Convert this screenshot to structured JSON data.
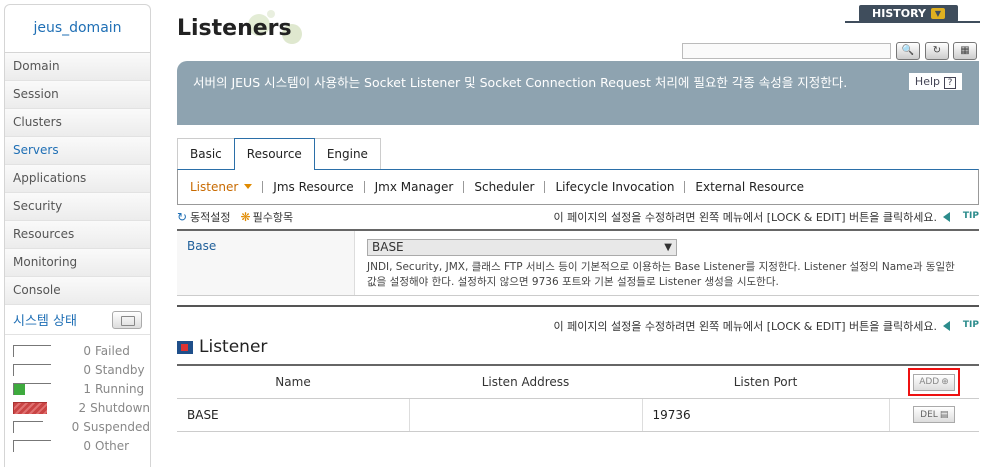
{
  "sidebar": {
    "domain": "jeus_domain",
    "items": [
      {
        "label": "Domain"
      },
      {
        "label": "Session"
      },
      {
        "label": "Clusters"
      },
      {
        "label": "Servers"
      },
      {
        "label": "Applications"
      },
      {
        "label": "Security"
      },
      {
        "label": "Resources"
      },
      {
        "label": "Monitoring"
      },
      {
        "label": "Console"
      }
    ],
    "active_item": "Servers",
    "system_status_title": "시스템 상태",
    "statuses": [
      {
        "count": "0",
        "label": "Failed"
      },
      {
        "count": "0",
        "label": "Standby"
      },
      {
        "count": "1",
        "label": "Running"
      },
      {
        "count": "2",
        "label": "Shutdown"
      },
      {
        "count": "0",
        "label": "Suspended"
      },
      {
        "count": "0",
        "label": "Other"
      }
    ]
  },
  "header": {
    "title": "Listeners",
    "history_label": "HISTORY",
    "help_label": "Help",
    "help_q": "?"
  },
  "banner": {
    "text": "서버의 JEUS 시스템이 사용하는 Socket Listener 및 Socket Connection Request 처리에 필요한 각종 속성을 지정한다."
  },
  "tabs": [
    {
      "label": "Basic"
    },
    {
      "label": "Resource"
    },
    {
      "label": "Engine"
    }
  ],
  "subnav": [
    {
      "label": "Listener"
    },
    {
      "label": "Jms Resource"
    },
    {
      "label": "Jmx Manager"
    },
    {
      "label": "Scheduler"
    },
    {
      "label": "Lifecycle Invocation"
    },
    {
      "label": "External Resource"
    }
  ],
  "meta": {
    "dynamic": "동적설정",
    "required": "필수항목",
    "tip_text": "이 페이지의 설정을 수정하려면 왼쪽 메뉴에서 [LOCK & EDIT] 버튼을 클릭하세요.",
    "tip_badge": "TIP"
  },
  "base": {
    "label": "Base",
    "value": "BASE",
    "description": "JNDI, Security, JMX, 클래스 FTP 서비스 등이 기본적으로 이용하는 Base Listener를 지정한다. Listener 설정의 Name과 동일한 값을 설정해야 한다. 설정하지 않으면 9736 포트와 기본 설정들로 Listener 생성을 시도한다."
  },
  "listener_section": {
    "title": "Listener",
    "columns": [
      "Name",
      "Listen Address",
      "Listen Port"
    ],
    "add_label": "ADD",
    "del_label": "DEL",
    "rows": [
      {
        "name": "BASE",
        "address": "",
        "port": "19736"
      }
    ]
  },
  "colors": {
    "accent": "#1f6fb5",
    "banner": "#8ea3b0",
    "history": "#3f4d5c",
    "highlight": "#e11111"
  }
}
